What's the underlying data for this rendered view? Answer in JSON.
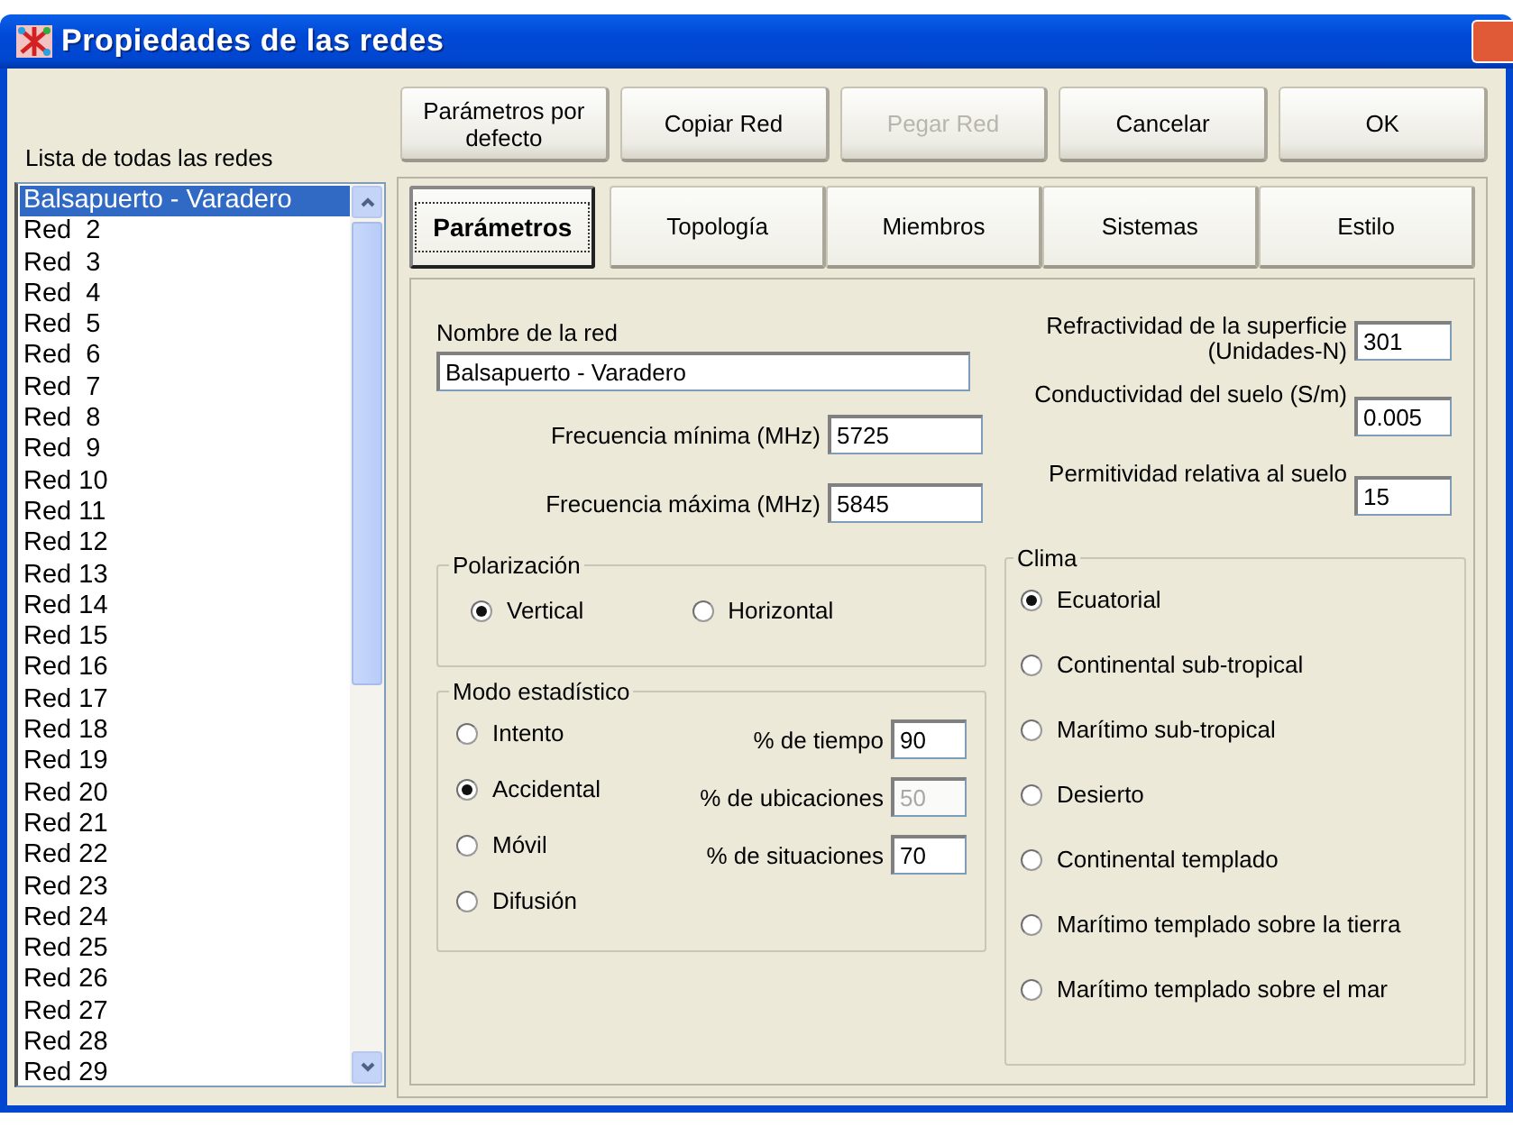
{
  "window": {
    "title": "Propiedades de las redes"
  },
  "network_list": {
    "label": "Lista de todas las redes",
    "items": [
      {
        "label": "Balsapuerto - Varadero",
        "selected": true
      },
      {
        "label": "Red  2",
        "selected": false
      },
      {
        "label": "Red  3",
        "selected": false
      },
      {
        "label": "Red  4",
        "selected": false
      },
      {
        "label": "Red  5",
        "selected": false
      },
      {
        "label": "Red  6",
        "selected": false
      },
      {
        "label": "Red  7",
        "selected": false
      },
      {
        "label": "Red  8",
        "selected": false
      },
      {
        "label": "Red  9",
        "selected": false
      },
      {
        "label": "Red 10",
        "selected": false
      },
      {
        "label": "Red 11",
        "selected": false
      },
      {
        "label": "Red 12",
        "selected": false
      },
      {
        "label": "Red 13",
        "selected": false
      },
      {
        "label": "Red 14",
        "selected": false
      },
      {
        "label": "Red 15",
        "selected": false
      },
      {
        "label": "Red 16",
        "selected": false
      },
      {
        "label": "Red 17",
        "selected": false
      },
      {
        "label": "Red 18",
        "selected": false
      },
      {
        "label": "Red 19",
        "selected": false
      },
      {
        "label": "Red 20",
        "selected": false
      },
      {
        "label": "Red 21",
        "selected": false
      },
      {
        "label": "Red 22",
        "selected": false
      },
      {
        "label": "Red 23",
        "selected": false
      },
      {
        "label": "Red 24",
        "selected": false
      },
      {
        "label": "Red 25",
        "selected": false
      },
      {
        "label": "Red 26",
        "selected": false
      },
      {
        "label": "Red 27",
        "selected": false
      },
      {
        "label": "Red 28",
        "selected": false
      },
      {
        "label": "Red 29",
        "selected": false
      }
    ]
  },
  "buttons": [
    {
      "label": "Parámetros por\ndefecto",
      "disabled": false
    },
    {
      "label": "Copiar Red",
      "disabled": false
    },
    {
      "label": "Pegar Red",
      "disabled": true
    },
    {
      "label": "Cancelar",
      "disabled": false
    },
    {
      "label": "OK",
      "disabled": false
    }
  ],
  "tabs": [
    {
      "label": "Parámetros",
      "selected": true
    },
    {
      "label": "Topología",
      "selected": false
    },
    {
      "label": "Miembros",
      "selected": false
    },
    {
      "label": "Sistemas",
      "selected": false
    },
    {
      "label": "Estilo",
      "selected": false
    }
  ],
  "parametros": {
    "network_name": {
      "label": "Nombre de la red",
      "value": "Balsapuerto - Varadero"
    },
    "frequency_fields": [
      {
        "label": "Frecuencia mínima (MHz)",
        "value": "5725"
      },
      {
        "label": "Frecuencia máxima (MHz)",
        "value": "5845"
      }
    ],
    "ground_fields": [
      {
        "label": "Refractividad de la superficie\n(Unidades-N)",
        "value": "301"
      },
      {
        "label": "Conductividad del suelo (S/m)",
        "value": "0.005"
      },
      {
        "label": "Permitividad relativa al suelo",
        "value": "15"
      }
    ],
    "polarization": {
      "title": "Polarización",
      "options": [
        {
          "label": "Vertical",
          "selected": true
        },
        {
          "label": "Horizontal",
          "selected": false
        }
      ]
    },
    "statistical_mode": {
      "title": "Modo estadístico",
      "options": [
        {
          "label": "Intento",
          "selected": false
        },
        {
          "label": "Accidental",
          "selected": true
        },
        {
          "label": "Móvil",
          "selected": false
        },
        {
          "label": "Difusión",
          "selected": false
        }
      ],
      "fields": [
        {
          "label": "% de tiempo",
          "value": "90",
          "disabled": false
        },
        {
          "label": "% de ubicaciones",
          "value": "50",
          "disabled": true
        },
        {
          "label": "% de situaciones",
          "value": "70",
          "disabled": false
        }
      ]
    },
    "climate": {
      "title": "Clima",
      "options": [
        {
          "label": "Ecuatorial",
          "selected": true
        },
        {
          "label": "Continental sub-tropical",
          "selected": false
        },
        {
          "label": "Marítimo sub-tropical",
          "selected": false
        },
        {
          "label": "Desierto",
          "selected": false
        },
        {
          "label": "Continental templado",
          "selected": false
        },
        {
          "label": "Marítimo templado sobre la tierra",
          "selected": false
        },
        {
          "label": "Marítimo templado sobre el mar",
          "selected": false
        }
      ]
    }
  }
}
